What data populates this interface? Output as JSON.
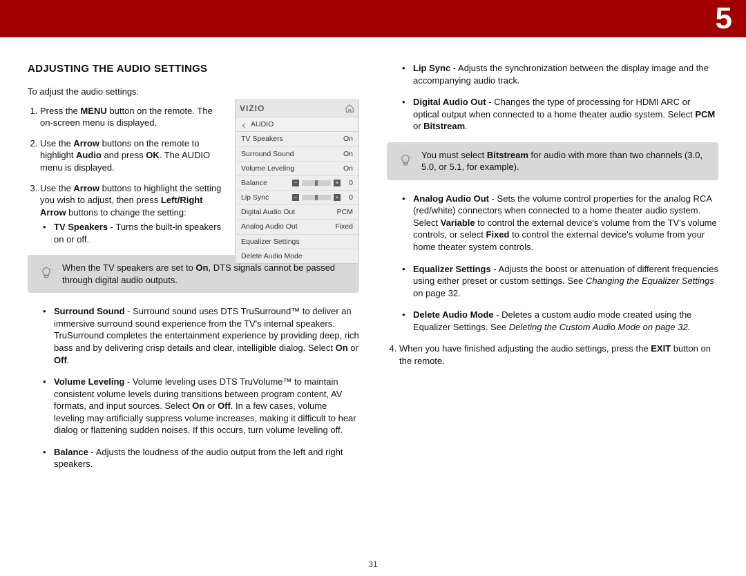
{
  "chapter": "5",
  "section_title": "ADJUSTING THE AUDIO SETTINGS",
  "page_number": "31",
  "intro": "To adjust the audio settings:",
  "steps": {
    "s1a": "Press the ",
    "s1b": "MENU",
    "s1c": " button on the remote. The on-screen menu is displayed.",
    "s2a": "Use the ",
    "s2b": "Arrow",
    "s2c": " buttons on the remote to highlight ",
    "s2d": "Audio",
    "s2e": " and press ",
    "s2f": "OK",
    "s2g": ". The AUDIO menu is displayed.",
    "s3a": "Use the ",
    "s3b": "Arrow",
    "s3c": " buttons to highlight the setting you wish to adjust, then press ",
    "s3d": "Left/Right Arrow",
    "s3e": " buttons to change the setting:",
    "s4a": "When you have finished adjusting the audio settings, press the ",
    "s4b": "EXIT",
    "s4c": " button on the remote."
  },
  "tip1": {
    "a": "When the TV speakers are set to ",
    "b": "On",
    "c": ", DTS signals cannot be passed through digital audio outputs."
  },
  "tip2": {
    "a": "You must select ",
    "b": "Bitstream",
    "c": " for audio with more than two channels (3.0, 5.0, or 5.1, for example)."
  },
  "items": {
    "tvspk_l": "TV Speakers",
    "tvspk_t": " - Turns the built-in speakers on or off.",
    "ss_l": "Surround Sound",
    "ss_t": " - Surround sound uses DTS TruSurround™ to deliver an immersive surround sound experience from the TV's internal speakers. TruSurround completes the entertainment experience by providing deep, rich bass and by delivering crisp details and clear, intelligible dialog. Select ",
    "ss_on": "On",
    "ss_or": " or ",
    "ss_off": "Off",
    "ss_end": ".",
    "vl_l": "Volume Leveling",
    "vl_t": " - Volume leveling uses DTS TruVolume™ to maintain consistent volume levels during transitions between program content, AV formats, and input sources. Select ",
    "vl_on": "On",
    "vl_or": " or ",
    "vl_off": "Off",
    "vl_t2": ". In a few cases, volume leveling may artificially suppress volume increases, making it difficult to hear dialog or flattening sudden noises. If this occurs, turn volume leveling off.",
    "bal_l": "Balance",
    "bal_t": " - Adjusts the loudness of the audio output from the left and right speakers.",
    "lip_l": "Lip Sync",
    "lip_t": " - Adjusts the synchronization between the display image and the accompanying audio track.",
    "dao_l": "Digital Audio Out",
    "dao_t": " - Changes the type of processing for HDMI ARC or optical output when connected to a home theater audio system. Select ",
    "dao_pcm": "PCM",
    "dao_or": " or ",
    "dao_bs": "Bitstream",
    "dao_end": ".",
    "aao_l": "Analog Audio Out",
    "aao_t": " - Sets the volume control properties for the analog RCA (red/white) connectors when connected to a home theater audio system. Select ",
    "aao_var": "Variable",
    "aao_t2": " to control the external device's volume from the TV's volume controls, or select ",
    "aao_fix": "Fixed",
    "aao_t3": " to control the external device's volume from your home theater system controls.",
    "eq_l": "Equalizer Settings",
    "eq_t": " - Adjusts the boost or attenuation of different frequencies using either preset or custom settings. See ",
    "eq_i": "Changing the Equalizer Settings",
    "eq_t2": " on page 32.",
    "del_l": "Delete Audio Mode",
    "del_t": " - Deletes a custom audio mode created using the Equalizer Settings. See ",
    "del_i": "Deleting the Custom Audio Mode on page 32."
  },
  "menu": {
    "brand": "VIZIO",
    "title": "AUDIO",
    "rows": [
      {
        "label": "TV Speakers",
        "value": "On",
        "type": "text"
      },
      {
        "label": "Surround Sound",
        "value": "On",
        "type": "text"
      },
      {
        "label": "Volume Leveling",
        "value": "On",
        "type": "text"
      },
      {
        "label": "Balance",
        "value": "0",
        "type": "slider"
      },
      {
        "label": "Lip Sync",
        "value": "0",
        "type": "slider"
      },
      {
        "label": "Digital Audio Out",
        "value": "PCM",
        "type": "text"
      },
      {
        "label": "Analog Audio Out",
        "value": "Fixed",
        "type": "text"
      },
      {
        "label": "Equalizer Settings",
        "value": "",
        "type": "text"
      },
      {
        "label": "Delete Audio Mode",
        "value": "",
        "type": "text"
      }
    ]
  }
}
